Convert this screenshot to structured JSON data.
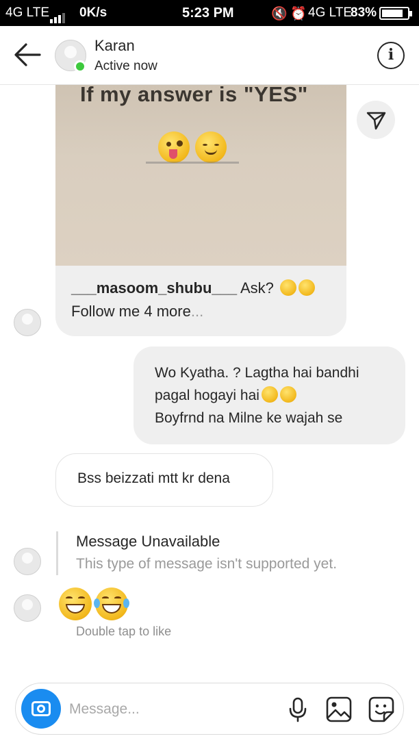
{
  "status_bar": {
    "network_left": "4G LTE",
    "speed": "0K/s",
    "time": "5:23 PM",
    "network_right": "4G LTE",
    "battery": "83%",
    "battery_level": 0.83
  },
  "header": {
    "contact_name": "Karan",
    "status": "Active now"
  },
  "shared_post": {
    "image_caption": "If my answer is \"YES\"",
    "author": "___masoom_shubu___",
    "text_after_author": " Ask? ",
    "second_line": "Follow me 4 more",
    "more": "..."
  },
  "messages": {
    "outgoing_lines": [
      "Wo Kyatha. ? Lagtha hai bandhi",
      "pagal hogayi hai",
      "Boyfrnd na Milne ke wajah se"
    ],
    "incoming_text": "Bss beizzati mtt kr dena",
    "unavailable_title": "Message Unavailable",
    "unavailable_subtitle": "This type of message isn't supported yet.",
    "double_tap_hint": "Double tap to like"
  },
  "composer": {
    "placeholder": "Message..."
  },
  "colors": {
    "accent_blue": "#1a8cf0",
    "online_green": "#3dc93d",
    "bubble_gray": "#efefef"
  },
  "icons": [
    "back-arrow-icon",
    "info-icon",
    "share-icon",
    "camera-icon",
    "microphone-icon",
    "gallery-icon",
    "sticker-icon"
  ]
}
